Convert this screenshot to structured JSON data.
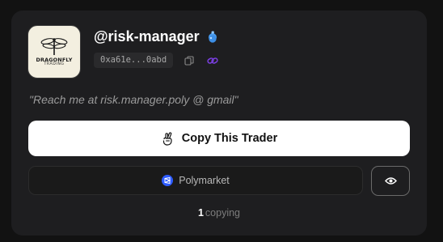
{
  "profile": {
    "avatar": {
      "logo_word": "DRAGONFLY",
      "logo_sub": "TRADING"
    },
    "username": "@risk-manager",
    "badge_icon": "blue-potion-icon",
    "address": "0xa61e...0abd",
    "copy_icon": "copy-icon",
    "link_icon": "link-icon",
    "bio": "\"Reach me at risk.manager.poly @ gmail\""
  },
  "actions": {
    "copy_label": "Copy This Trader",
    "copy_icon": "fingers-crossed-icon",
    "platform_label": "Polymarket",
    "platform_icon": "polymarket-icon",
    "watch_icon": "eye-icon"
  },
  "stats": {
    "copying_count": "1",
    "copying_label": "copying"
  },
  "colors": {
    "background": "#121212",
    "card": "#1e1e20",
    "primary_button": "#ffffff",
    "polymarket_blue": "#2d5bff",
    "link_purple": "#7b3fe4"
  }
}
